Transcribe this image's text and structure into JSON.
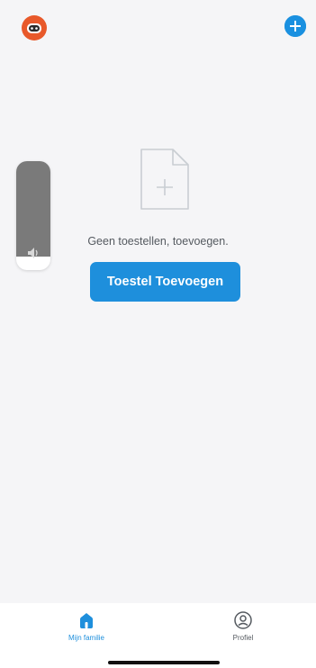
{
  "header": {
    "avatar_icon": "robot-avatar-icon",
    "add_icon": "plus-circle-icon",
    "accent_color": "#1e8fdc"
  },
  "volume_overlay": {
    "icon": "speaker-icon",
    "level": 0.88
  },
  "empty_state": {
    "icon": "add-file-icon",
    "message": "Geen toestellen, toevoegen.",
    "button_label": "Toestel Toevoegen"
  },
  "tabbar": {
    "tabs": [
      {
        "label": "Mijn familie",
        "icon": "home-icon",
        "active": true
      },
      {
        "label": "Profiel",
        "icon": "profile-icon",
        "active": false
      }
    ]
  }
}
